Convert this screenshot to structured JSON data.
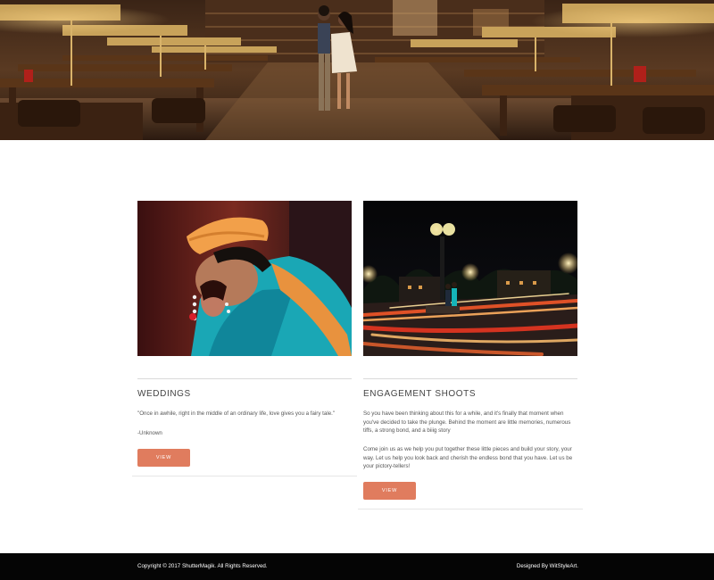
{
  "hero": {
    "image": "library-couple-photo"
  },
  "cards": [
    {
      "title": "WEDDINGS",
      "image": "wedding-couple-photo",
      "quote": "\"Once in awhile, right in the middle of an ordinary life, love gives you a fairy tale.\"",
      "author": "-Unknown",
      "button": "VIEW"
    },
    {
      "title": "ENGAGEMENT SHOOTS",
      "image": "night-clock-engagement-photo",
      "paragraph1": "So you have been thinking about this for a while, and it's finally that moment when you've decided to take the plunge. Behind the moment are little memories, numerous tiffs, a strong bond, and a biiig story",
      "paragraph2": "Come join us as we help you put together these little pieces and build your story, your way. Let us help you look back and cherish the endless bond that you have. Let us be your pictory-tellers!",
      "button": "VIEW"
    }
  ],
  "footer": {
    "copyright": "Copyright © 2017 ShutterMagik. All Rights Reserved.",
    "designed_prefix": "Designed By ",
    "designed_brand": "WitStyleArt."
  },
  "colors": {
    "accent": "#e07c5e",
    "footer_bg": "#050505",
    "background": "#ffffff"
  }
}
